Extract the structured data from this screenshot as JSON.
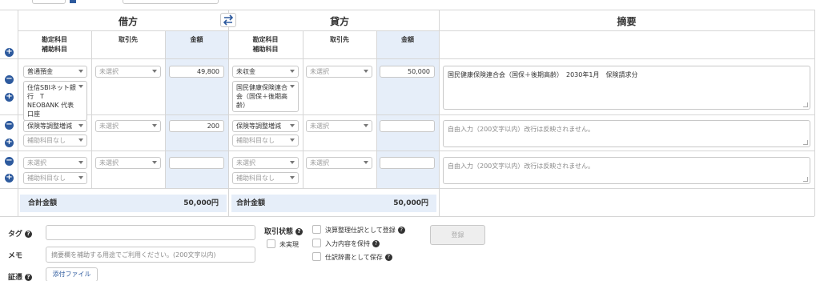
{
  "header": {
    "debit": "借方",
    "credit": "貸方",
    "memo": "摘要"
  },
  "columns": {
    "account_line1": "勘定科目",
    "account_line2": "補助科目",
    "partner": "取引先",
    "amount": "金額"
  },
  "rows": [
    {
      "debit_account": "普通預金",
      "debit_sub": "住信SBIネット銀行　T NEOBANK 代表口座",
      "debit_partner": "未選択",
      "debit_amount": "49,800",
      "credit_account": "未収金",
      "credit_sub": "国民健康保険連合会（国保＋後期高齢）",
      "credit_partner": "未選択",
      "credit_amount": "50,000",
      "memo": "国民健康保険連合会（国保＋後期高齢）　2030年1月　保険請求分"
    },
    {
      "debit_account": "保険等調整増減",
      "debit_sub": "補助科目なし",
      "debit_partner": "未選択",
      "debit_amount": "200",
      "credit_account": "保険等調整増減",
      "credit_sub": "補助科目なし",
      "credit_partner": "未選択",
      "credit_amount": "",
      "memo_placeholder": "自由入力（200文字以内）改行は反映されません。"
    },
    {
      "debit_account": "未選択",
      "debit_sub": "補助科目なし",
      "debit_partner": "未選択",
      "debit_amount": "",
      "credit_account": "未選択",
      "credit_sub": "補助科目なし",
      "credit_partner": "未選択",
      "credit_amount": "",
      "memo_placeholder": "自由入力（200文字以内）改行は反映されません。"
    }
  ],
  "totals": {
    "label": "合計金額",
    "debit": "50,000円",
    "credit": "50,000円"
  },
  "footer": {
    "tag_label": "タグ",
    "memo_label": "メモ",
    "memo_placeholder": "摘要欄を補助する用途でご利用ください。(200文字以内)",
    "evidence_label": "証憑",
    "attach_button": "添付ファイル",
    "status_label": "取引状態",
    "unrealized": "未実現",
    "opt_settlement": "決算整理仕訳として登録",
    "opt_keep": "入力内容を保持",
    "opt_dictionary": "仕訳辞書として保存",
    "register_button": "登録"
  },
  "icons": {
    "swap": "swap-icon",
    "add": "plus-circle-icon",
    "remove": "minus-circle-icon",
    "help": "question-circle-icon"
  },
  "colors": {
    "accent": "#2d5a9e",
    "amount_bg": "#e6eef9"
  }
}
